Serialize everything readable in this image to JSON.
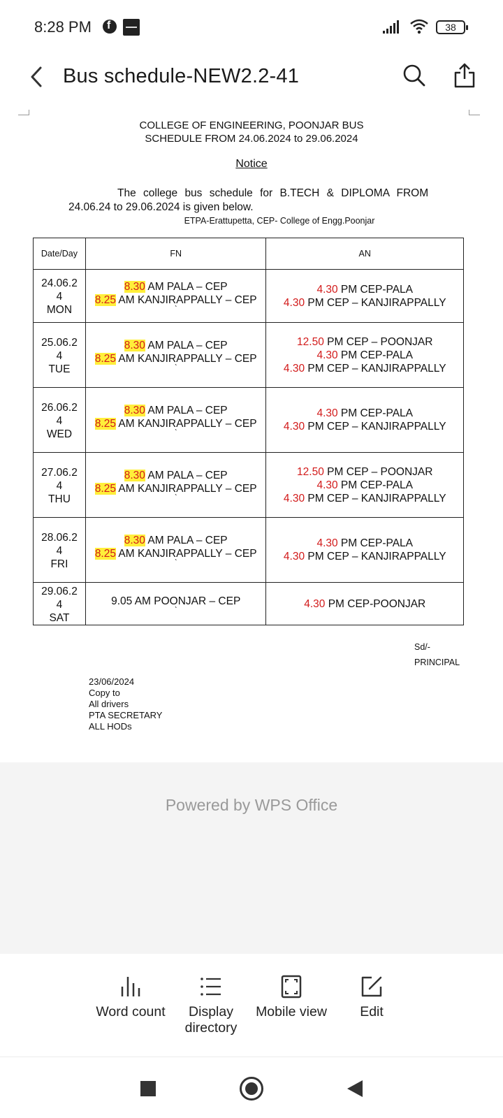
{
  "status_bar": {
    "time": "8:28 PM",
    "battery": "38",
    "icons": [
      "facebook-icon",
      "zomato-icon",
      "signal-icon",
      "wifi-icon",
      "battery-icon"
    ]
  },
  "title_bar": {
    "title": "Bus schedule-NEW2.2-41",
    "icons": [
      "back-icon",
      "search-icon",
      "share-icon"
    ]
  },
  "document": {
    "heading_line1": "COLLEGE OF ENGINEERING, POONJAR BUS",
    "heading_line2": "SCHEDULE FROM 24.06.2024 to 29.06.2024",
    "notice": "Notice",
    "para_line1": "The college bus schedule for B.TECH & DIPLOMA FROM",
    "para_line2": "24.06.24 to 29.06.2024 is given below.",
    "legend": "ETPA-Erattupetta, CEP- College of Engg.Poonjar",
    "table": {
      "headers": [
        "Date/Day",
        "FN",
        "AN"
      ],
      "rows": [
        {
          "date_a": "24.06.2",
          "date_b": "4",
          "day": "MON",
          "fn": [
            {
              "time": "8.30",
              "rest": " AM PALA – CEP"
            },
            {
              "time": "8.25",
              "rest": " AM KANJIRAPPALLY – CEP"
            }
          ],
          "an": [
            {
              "time": "4.30",
              "rest": " PM CEP-PALA"
            },
            {
              "time": "4.30",
              "rest": " PM CEP – KANJIRAPPALLY"
            }
          ]
        },
        {
          "date_a": "25.06.2",
          "date_b": "4",
          "day": "TUE",
          "fn": [
            {
              "time": "8.30",
              "rest": " AM PALA – CEP"
            },
            {
              "time": "8.25",
              "rest": " AM KANJIRAPPALLY – CEP"
            }
          ],
          "an": [
            {
              "time": "12.50",
              "rest": " PM CEP – POONJAR"
            },
            {
              "time": "4.30",
              "rest": " PM CEP-PALA"
            },
            {
              "time": "4.30",
              "rest": " PM CEP – KANJIRAPPALLY"
            }
          ]
        },
        {
          "date_a": "26.06.2",
          "date_b": "4",
          "day": "WED",
          "fn": [
            {
              "time": "8.30",
              "rest": " AM PALA – CEP"
            },
            {
              "time": "8.25",
              "rest": " AM KANJIRAPPALLY – CEP"
            }
          ],
          "an": [
            {
              "time": "4.30",
              "rest": " PM CEP-PALA"
            },
            {
              "time": "4.30",
              "rest": " PM CEP – KANJIRAPPALLY"
            }
          ]
        },
        {
          "date_a": "27.06.2",
          "date_b": "4",
          "day": "THU",
          "fn": [
            {
              "time": "8.30",
              "rest": " AM PALA – CEP"
            },
            {
              "time": "8.25",
              "rest": " AM KANJIRAPPALLY – CEP"
            }
          ],
          "an": [
            {
              "time": "12.50",
              "rest": " PM CEP – POONJAR"
            },
            {
              "time": "4.30",
              "rest": " PM CEP-PALA"
            },
            {
              "time": "4.30",
              "rest": " PM CEP – KANJIRAPPALLY"
            }
          ]
        },
        {
          "date_a": "28.06.2",
          "date_b": "4",
          "day": "FRI",
          "fn": [
            {
              "time": "8.30",
              "rest": " AM PALA – CEP"
            },
            {
              "time": "8.25",
              "rest": " AM KANJIRAPPALLY – CEP"
            }
          ],
          "an": [
            {
              "time": "4.30",
              "rest": " PM CEP-PALA"
            },
            {
              "time": "4.30",
              "rest": " PM CEP – KANJIRAPPALLY"
            }
          ]
        },
        {
          "date_a": "29.06.2",
          "date_b": "4",
          "day": "SAT",
          "fn_plain": "9.05 AM POONJAR – CEP",
          "an": [
            {
              "time": "4.30",
              "rest": " PM CEP-POONJAR"
            }
          ]
        }
      ]
    },
    "sd": "Sd/-",
    "principal": "PRINCIPAL",
    "footer": {
      "date": "23/06/2024",
      "copy_to": "Copy to",
      "line1": "All drivers",
      "line2": "PTA SECRETARY",
      "line3": "ALL HODs"
    }
  },
  "powered_by": "Powered by WPS Office",
  "toolbar": {
    "word_count": "Word count",
    "display_directory_1": "Display",
    "display_directory_2": "directory",
    "mobile_view": "Mobile view",
    "edit": "Edit"
  },
  "colors": {
    "highlight": "#ffef3a",
    "time_red": "#d21a1a",
    "powered_bg": "#f4f4f4"
  }
}
